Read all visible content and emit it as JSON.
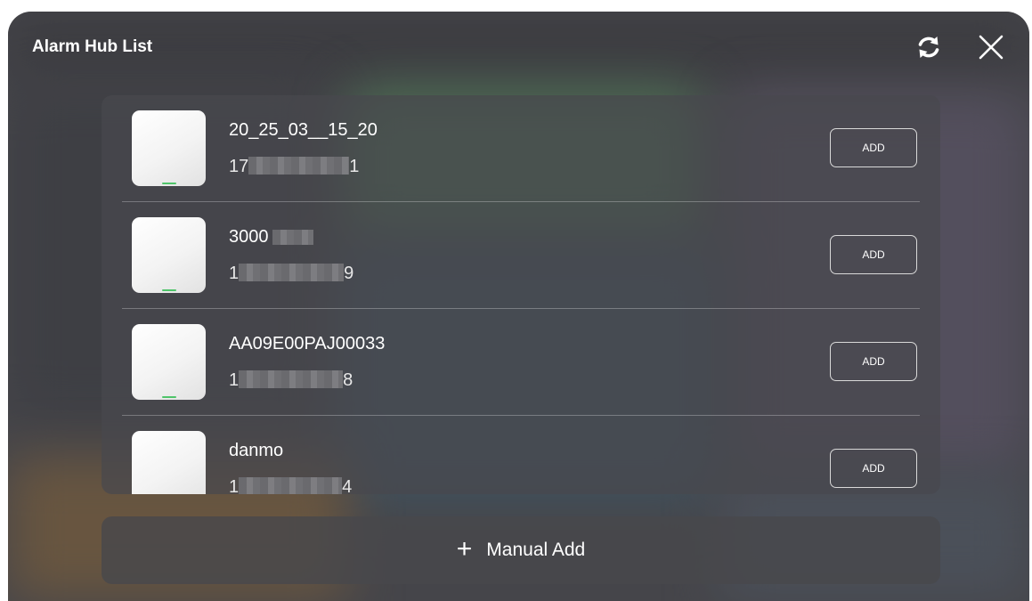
{
  "header": {
    "title": "Alarm Hub List",
    "refresh_icon": "refresh-icon",
    "close_icon": "close-icon"
  },
  "hubs": [
    {
      "name": "20_25_03__15_20",
      "serial_start": "17",
      "serial_end": "1",
      "add_label": "ADD"
    },
    {
      "name": "3000",
      "serial_start": "1",
      "serial_end": "9",
      "add_label": "ADD"
    },
    {
      "name": "AA09E00PAJ00033",
      "serial_start": "1",
      "serial_end": "8",
      "add_label": "ADD"
    },
    {
      "name": "danmo",
      "serial_start": "1",
      "serial_end": "4",
      "add_label": "ADD"
    }
  ],
  "manual_add": {
    "icon": "plus-icon",
    "label": "Manual Add"
  },
  "colors": {
    "accent_led": "#4fc46a",
    "panel": "#48484e",
    "text": "#ffffff"
  }
}
